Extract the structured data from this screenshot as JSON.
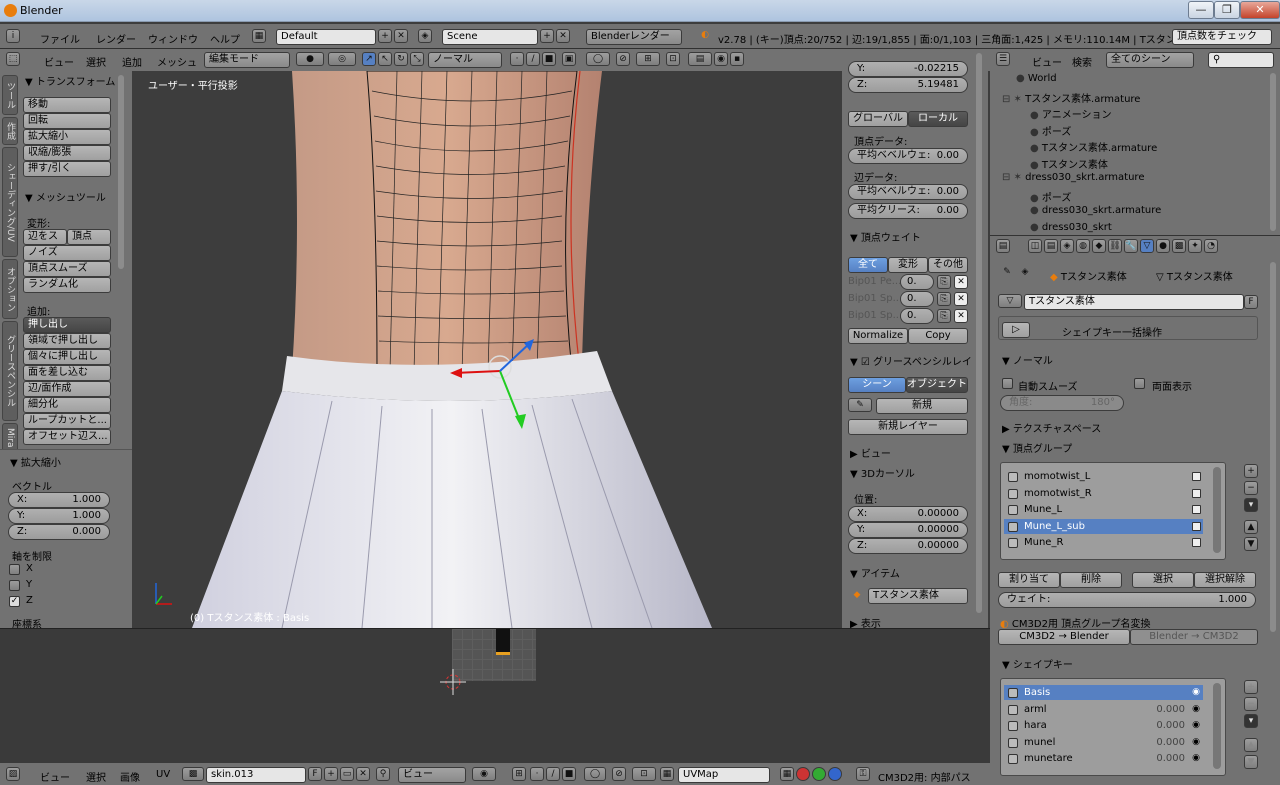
{
  "window": {
    "title": "Blender",
    "minimize": "—",
    "maximize": "❐",
    "close": "✕"
  },
  "info_header": {
    "menus": [
      "ファイル",
      "レンダー",
      "ウィンドウ",
      "ヘルプ"
    ],
    "layout": "Default",
    "scene": "Scene",
    "engine": "Blenderレンダー",
    "stats": "v2.78 | (キー)頂点:20/752 | 辺:19/1,855 | 面:0/1,103 | 三角面:1,425 | メモリ:110.14M | Tスタンス素体",
    "check_button": "頂点数をチェック"
  },
  "view3d_header": {
    "menus": [
      "ビュー",
      "選択",
      "追加",
      "メッシュ"
    ],
    "mode": "編集モード",
    "orientation": "ノーマル"
  },
  "toolshelf": {
    "tabs": [
      "ツール",
      "作成",
      "シェーディング/UV",
      "オプション",
      "グリースペンシル",
      "Mira"
    ],
    "transform_title": "トランスフォーム",
    "transform_buttons": [
      "移動",
      "回転",
      "拡大縮小",
      "収縮/膨張",
      "押す/引く"
    ],
    "mesh_tools_title": "メッシュツール",
    "deform_label": "変形:",
    "slide_edge": "辺をス",
    "slide_vertex": "頂点",
    "deform_buttons": [
      "ノイズ",
      "頂点スムーズ",
      "ランダム化"
    ],
    "add_label": "追加:",
    "extrude": "押し出し",
    "add_buttons": [
      "領域で押し出し",
      "個々に押し出し",
      "面を差し込む",
      "辺/面作成",
      "細分化",
      "ループカットと...",
      "オフセット辺ス..."
    ]
  },
  "operator": {
    "title": "拡大縮小",
    "vector_label": "ベクトル",
    "x_label": "X:",
    "x": "1.000",
    "y_label": "Y:",
    "y": "1.000",
    "z_label": "Z:",
    "z": "0.000",
    "constraint_label": "軸を制限",
    "axes": [
      "X",
      "Y",
      "Z"
    ],
    "axes_checked": [
      false,
      false,
      true
    ],
    "orientation_label": "座標系"
  },
  "viewport": {
    "view_label": "ユーザー・平行投影",
    "object_label": "(0) Tスタンス素体 : Basis"
  },
  "npanel": {
    "y_label": "Y:",
    "y": "-0.02215",
    "z_label": "Z:",
    "z": "5.19481",
    "global": "グローバル",
    "local": "ローカル",
    "vertex_data": "頂点データ:",
    "mean_bevel_weight": "平均ベベルウェ:",
    "v_bevel": "0.00",
    "edge_data": "辺データ:",
    "e_bevel_label": "平均ベベルウェ:",
    "e_bevel": "0.00",
    "mean_crease": "平均クリース:",
    "e_crease": "0.00",
    "vertex_weights": "頂点ウェイト",
    "vw_tabs": [
      "全て",
      "変形",
      "その他"
    ],
    "vw_rows": [
      {
        "name": "Bip01 Pe...",
        "val": "0."
      },
      {
        "name": "Bip01 Sp...",
        "val": "0."
      },
      {
        "name": "Bip01 Sp...",
        "val": "0."
      }
    ],
    "normalize": "Normalize",
    "copy": "Copy",
    "grease": "グリースペンシルレイ",
    "gp_scene": "シーン",
    "gp_object": "オブジェクト",
    "gp_new": "新規",
    "gp_new_layer": "新規レイヤー",
    "view": "ビュー",
    "cursor3d": "3Dカーソル",
    "location": "位置:",
    "cx_label": "X:",
    "cx": "0.00000",
    "cy_label": "Y:",
    "cy": "0.00000",
    "cz_label": "Z:",
    "cz": "0.00000",
    "item": "アイテム",
    "item_name": "Tスタンス素体",
    "display": "表示"
  },
  "uv_header": {
    "menus": [
      "ビュー",
      "選択",
      "画像",
      "UV"
    ],
    "image": "skin.013",
    "image_f": "F",
    "pivot": "ビュー",
    "uvmap": "UVMap",
    "addon_label": "CM3D2用: 内部パス"
  },
  "outliner": {
    "menus": [
      "ビュー",
      "検索"
    ],
    "filter": "全てのシーン",
    "rows": [
      {
        "label": "World",
        "indent": 1
      },
      {
        "label": "Tスタンス素体.armature",
        "indent": 0
      },
      {
        "label": "アニメーション",
        "indent": 2
      },
      {
        "label": "ポーズ",
        "indent": 2
      },
      {
        "label": "Tスタンス素体.armature",
        "indent": 2
      },
      {
        "label": "Tスタンス素体",
        "indent": 2
      },
      {
        "label": "dress030_skrt.armature",
        "indent": 0
      },
      {
        "label": "ポーズ",
        "indent": 2
      },
      {
        "label": "dress030_skrt.armature",
        "indent": 2
      },
      {
        "label": "dress030_skrt",
        "indent": 2
      }
    ]
  },
  "properties": {
    "breadcrumb_obj": "Tスタンス素体",
    "breadcrumb_mesh": "Tスタンス素体",
    "mesh_name": "Tスタンス素体",
    "mesh_f": "F",
    "shapekey_batch": "シェイプキー一括操作",
    "normals": "ノーマル",
    "auto_smooth": "自動スムーズ",
    "double_sided": "両面表示",
    "angle_label": "角度:",
    "angle": "180°",
    "texture_space": "テクスチャスペース",
    "vertex_groups": "頂点グループ",
    "vg_items": [
      "momotwist_L",
      "momotwist_R",
      "Mune_L",
      "Mune_L_sub",
      "Mune_R"
    ],
    "vg_selected": 3,
    "assign": "割り当て",
    "remove": "削除",
    "select": "選択",
    "deselect": "選択解除",
    "weight_label": "ウェイト:",
    "weight": "1.000",
    "cm3d2_vg": "CM3D2用 頂点グループ名変換",
    "cm3d2_to_blender": "CM3D2 → Blender",
    "blender_to_cm3d2": "Blender → CM3D2",
    "shape_keys": "シェイプキー",
    "sk_items": [
      {
        "name": "Basis",
        "val": ""
      },
      {
        "name": "arml",
        "val": "0.000"
      },
      {
        "name": "hara",
        "val": "0.000"
      },
      {
        "name": "munel",
        "val": "0.000"
      },
      {
        "name": "munetare",
        "val": "0.000"
      }
    ],
    "sk_selected": 0
  },
  "colors": {
    "accent": "#5680c2",
    "orange": "#e87d0d",
    "panel": "#727272",
    "viewport": "#3d3d3d"
  }
}
